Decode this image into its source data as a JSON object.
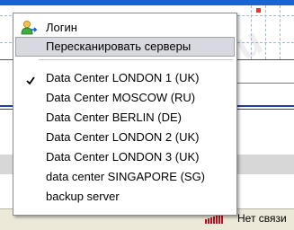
{
  "menu": {
    "login": {
      "label": "Логин",
      "icon": "user-login-icon"
    },
    "rescan": {
      "label": "Пересканировать серверы"
    },
    "servers": [
      {
        "label": "Data Center LONDON 1 (UK)",
        "checked": true
      },
      {
        "label": "Data Center MOSCOW (RU)",
        "checked": false
      },
      {
        "label": "Data Center BERLIN (DE)",
        "checked": false
      },
      {
        "label": "Data Center LONDON 2 (UK)",
        "checked": false
      },
      {
        "label": "Data Center LONDON 3 (UK)",
        "checked": false
      },
      {
        "label": "data center SINGAPORE (SG)",
        "checked": false
      },
      {
        "label": "backup server",
        "checked": false
      }
    ]
  },
  "status_bar": {
    "connection_text": "Нет связи",
    "signal_icon": "signal-strength-icon"
  },
  "colors": {
    "highlight": "#d8d8e0",
    "accent_blue": "#1e61d6",
    "signal_red": "#c0101a"
  }
}
